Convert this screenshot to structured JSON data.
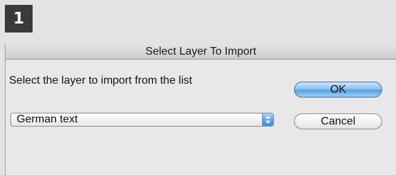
{
  "step_badge": "1",
  "dialog": {
    "title": "Select Layer To Import",
    "prompt": "Select the layer to import from the list",
    "layer_select": {
      "value": "German text",
      "icon": "up-down-arrows-icon"
    },
    "buttons": {
      "ok_label": "OK",
      "cancel_label": "Cancel"
    }
  },
  "colors": {
    "background": "#e3e3e3",
    "badge": "#3a3a3a",
    "default_button_blue": "#5aa2e4"
  }
}
